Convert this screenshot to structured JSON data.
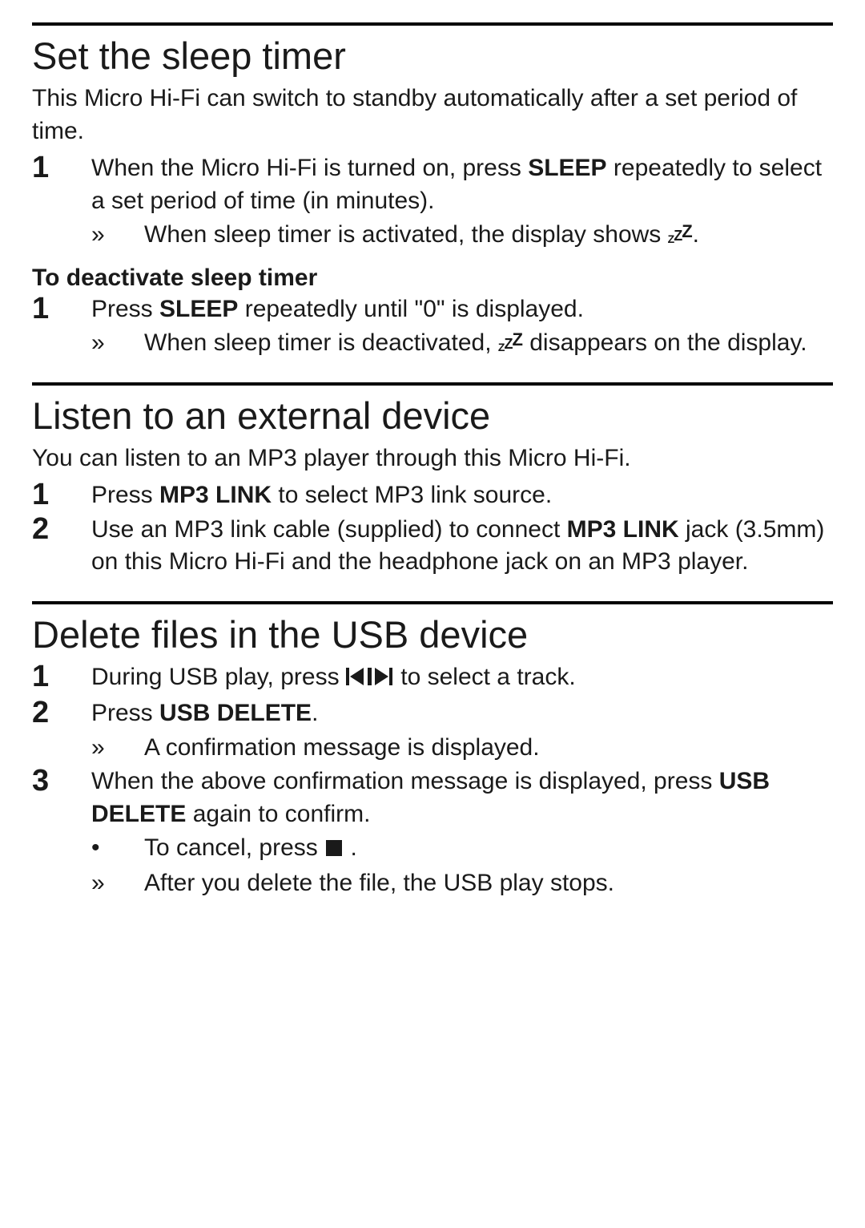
{
  "sections": [
    {
      "id": "sleep",
      "title": "Set the sleep timer",
      "intro": "This Micro Hi-Fi can switch to standby automatically after a set period of time.",
      "steps": [
        {
          "num": "1",
          "frags": [
            {
              "t": "When the Micro Hi-Fi is turned on, press "
            },
            {
              "t": "SLEEP",
              "b": true
            },
            {
              "t": " repeatedly to select a set period of time (in minutes)."
            }
          ],
          "sub": [
            {
              "mark": "»",
              "frags": [
                {
                  "t": "When sleep timer is activated, the display shows "
                },
                {
                  "icon": "zzz"
                },
                {
                  "t": "."
                }
              ]
            }
          ]
        }
      ],
      "subhead": "To deactivate sleep timer",
      "steps2": [
        {
          "num": "1",
          "frags": [
            {
              "t": "Press "
            },
            {
              "t": "SLEEP",
              "b": true
            },
            {
              "t": " repeatedly until \"0\" is displayed."
            }
          ],
          "sub": [
            {
              "mark": "»",
              "frags": [
                {
                  "t": "When sleep timer is deactivated, "
                },
                {
                  "icon": "zzz"
                },
                {
                  "t": " disappears on the display."
                }
              ]
            }
          ]
        }
      ]
    },
    {
      "id": "external",
      "title": "Listen to an external device",
      "intro": "You can listen to an MP3 player through this Micro Hi-Fi.",
      "steps": [
        {
          "num": "1",
          "frags": [
            {
              "t": "Press "
            },
            {
              "t": "MP3 LINK",
              "b": true
            },
            {
              "t": " to select MP3 link source."
            }
          ]
        },
        {
          "num": "2",
          "frags": [
            {
              "t": "Use an MP3 link cable (supplied) to connect "
            },
            {
              "t": "MP3 LINK",
              "b": true
            },
            {
              "t": " jack (3.5mm) on this Micro Hi-Fi and the headphone jack on an MP3 player."
            }
          ]
        }
      ]
    },
    {
      "id": "usb",
      "title": "Delete files in the USB device",
      "steps": [
        {
          "num": "1",
          "frags": [
            {
              "t": "During USB play, press "
            },
            {
              "icon": "prevnext"
            },
            {
              "t": " to select a track."
            }
          ]
        },
        {
          "num": "2",
          "frags": [
            {
              "t": "Press "
            },
            {
              "t": "USB DELETE",
              "b": true
            },
            {
              "t": "."
            }
          ],
          "sub": [
            {
              "mark": "»",
              "frags": [
                {
                  "t": "A confirmation message is displayed."
                }
              ]
            }
          ]
        },
        {
          "num": "3",
          "frags": [
            {
              "t": "When the above confirmation message is displayed, press "
            },
            {
              "t": "USB DELETE",
              "b": true
            },
            {
              "t": " again to confirm."
            }
          ],
          "sub": [
            {
              "mark": "•",
              "frags": [
                {
                  "t": "To cancel, press "
                },
                {
                  "icon": "stop"
                },
                {
                  "t": " ."
                }
              ]
            },
            {
              "mark": "»",
              "frags": [
                {
                  "t": "After you delete the file, the USB play stops."
                }
              ]
            }
          ]
        }
      ]
    }
  ]
}
